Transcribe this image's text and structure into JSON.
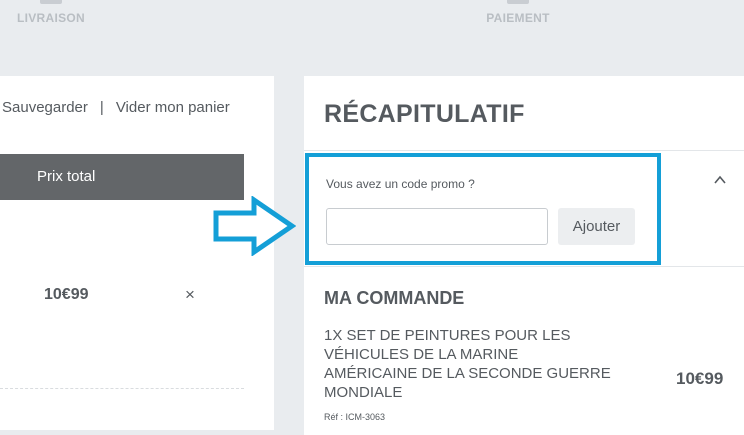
{
  "steps": {
    "livraison": "LIVRAISON",
    "paiement": "PAIEMENT"
  },
  "cart": {
    "save_label": "Sauvegarder",
    "separator": "|",
    "empty_label": "Vider mon panier",
    "header_total": "Prix total",
    "item_price": "10€99",
    "remove_glyph": "×"
  },
  "summary": {
    "title": "RÉCAPITULATIF",
    "promo_label": "Vous avez un code promo ?",
    "promo_input_value": "",
    "promo_input_placeholder": "",
    "promo_button": "Ajouter",
    "order_title": "MA COMMANDE",
    "product_name": "1X SET DE PEINTURES POUR LES VÉHICULES DE LA MARINE AMÉRICAINE DE LA SECONDE GUERRE MONDIALE",
    "product_price": "10€99",
    "product_ref": "Réf : ICM-3063"
  },
  "colors": {
    "highlight": "#149fd7",
    "header_bg": "#636669",
    "page_bg": "#e9ecef"
  },
  "icons": {
    "arrow": "right-arrow-outline-icon",
    "remove": "close-icon",
    "collapse": "chevron-up-icon"
  }
}
